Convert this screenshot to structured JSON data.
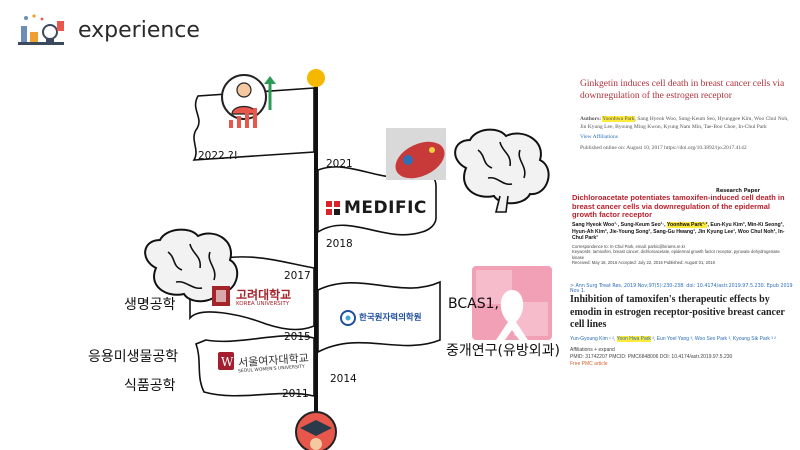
{
  "header": {
    "title": "experience",
    "icon": "lab-equipment-icon"
  },
  "timeline": {
    "years": {
      "y2022": "2022 ?!",
      "y2021": "2021",
      "y2018": "2018",
      "y2017": "2017",
      "y2015": "2015",
      "y2014": "2014",
      "y2011": "2011"
    },
    "flags": {
      "medific": "MEDIFIC",
      "korea_kr": "고려대학교",
      "korea_en": "KOREA UNIVERSITY",
      "kirams": "한국원자력의학원",
      "swu_kr": "서울여자대학교",
      "swu_en": "SEOUL WOMEN'S UNIVERSITY"
    },
    "left_labels": {
      "bio": "생명공학",
      "microbio": "응용미생물공학",
      "food": "식품공학"
    },
    "right_labels": {
      "bcas1": "BCAS1,",
      "research": "중개연구(유방외과)"
    }
  },
  "papers": {
    "p1": {
      "title": "Ginkgetin induces cell death in breast cancer cells via downregulation of the estrogen receptor",
      "authors_prefix": "Authors:",
      "author_hl": "Yoonhwa Park",
      "authors_rest": ", Sang Hyeok Woo, Sung-Keum Seo, Hyunggee Kim, Woo Chul Noh, Jin Kyung Lee, Byoung Ming Kwon, Kyung Nam Min, Tae-Boo Choe, In-Chul Park",
      "view": "View Affiliations",
      "published": "Published online on: August 10, 2017    https://doi.org/10.3892/ijo.2017.4142"
    },
    "p2": {
      "kind": "Research Paper",
      "title": "Dichloroacetate potentiates tamoxifen-induced cell death in breast cancer cells via downregulation of the epidermal growth factor receptor",
      "authors_a": "Sang Hyeok Woo¹·, Sung-Keum Seo¹·, ",
      "author_hl": "Yoonhwa Park¹·²",
      "authors_b": ", Eun-Kyu Kim³, Min-Ki Seong³, Hyun-Ah Kim³, Jie-Young Song¹, Sang-Gu Hwang¹, Jin Kyung Lee¹, Woo Chul Noh³, In-Chul Park¹",
      "corr": "Correspondence to: In-Chul Park, email: parkic@kirams.re.kr",
      "keywords": "Keywords: tamoxifen, breast cancer, dichloroacetate, epidermal growth factor receptor, pyruvate dehydrogenase kinase",
      "dates": "Received: May 18, 2016     Accepted: July 22, 2016     Published: August 01, 2016"
    },
    "p3": {
      "cite": "> Ann Surg Treat Res. 2019 Nov;97(5):230-238. doi: 10.4174/astr.2019.97.5.230. Epub 2019 Nov 1.",
      "title": "Inhibition of tamoxifen's therapeutic effects by emodin in estrogen receptor-positive breast cancer cell lines",
      "authors_a": "Yun-Gyoung Kim ¹ ², ",
      "author_hl": "Yoon Hwa Park",
      "authors_b": " ³, Eun Yoel Yang ³, Woo Seo Park ³, Kyoung Sik Park ³ ²",
      "affil": "Affiliations  + expand",
      "ids": "PMID: 31742207   PMCID: PMC6848006   DOI: 10.4174/astr.2019.97.5.230",
      "free": "Free PMC article"
    }
  },
  "colors": {
    "paper1_title": "#b0313b",
    "paper2_title": "#b8202c",
    "link_blue": "#2a6ebb",
    "highlight": "#ffeb3b",
    "pole_top": "#f5b800",
    "medific_red": "#d8232a",
    "korea_red": "#a3252b",
    "kirams_blue": "#1e4e9c",
    "ribbon_pink": "#f2a0b6"
  }
}
